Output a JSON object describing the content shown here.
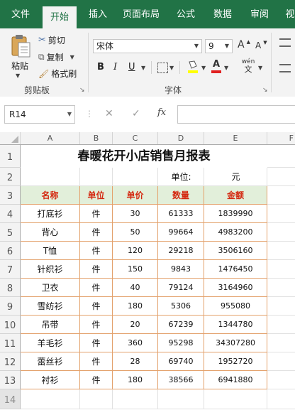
{
  "ribbon_tabs": [
    "文件",
    "开始",
    "插入",
    "页面布局",
    "公式",
    "数据",
    "审阅",
    "视"
  ],
  "clipboard": {
    "paste": "粘贴",
    "cut": "剪切",
    "copy": "复制",
    "format_painter": "格式刷",
    "group": "剪贴板"
  },
  "font": {
    "name": "宋体",
    "size": "9",
    "grow": "A",
    "shrink": "A",
    "bold": "B",
    "italic": "I",
    "underline": "U",
    "phonetic": "wén",
    "group": "字体"
  },
  "formula_bar": {
    "name_box": "R14",
    "fx": "fx",
    "cancel": "✕",
    "enter": "✓",
    "value": ""
  },
  "columns": [
    "A",
    "B",
    "C",
    "D",
    "E",
    "F"
  ],
  "rows": [
    "1",
    "2",
    "3",
    "4",
    "5",
    "6",
    "7",
    "8",
    "9",
    "10",
    "11",
    "12",
    "13",
    "14"
  ],
  "sheet": {
    "title": "春暖花开小店销售月报表",
    "unit_label": "单位:",
    "unit_value": "元",
    "headers": [
      "名称",
      "单位",
      "单价",
      "数量",
      "金额"
    ],
    "data": [
      [
        "打底衫",
        "件",
        "30",
        "61333",
        "1839990"
      ],
      [
        "背心",
        "件",
        "50",
        "99664",
        "4983200"
      ],
      [
        "T恤",
        "件",
        "120",
        "29218",
        "3506160"
      ],
      [
        "针织衫",
        "件",
        "150",
        "9843",
        "1476450"
      ],
      [
        "卫衣",
        "件",
        "40",
        "79124",
        "3164960"
      ],
      [
        "雪纺衫",
        "件",
        "180",
        "5306",
        "955080"
      ],
      [
        "吊带",
        "件",
        "20",
        "67239",
        "1344780"
      ],
      [
        "羊毛衫",
        "件",
        "360",
        "95298",
        "34307280"
      ],
      [
        "蕾丝衫",
        "件",
        "28",
        "69740",
        "1952720"
      ],
      [
        "衬衫",
        "件",
        "180",
        "38566",
        "6941880"
      ]
    ]
  },
  "colors": {
    "brand": "#217346",
    "header_fill": "#e2efda",
    "header_text": "#d42a12",
    "border": "#e3a16b"
  }
}
